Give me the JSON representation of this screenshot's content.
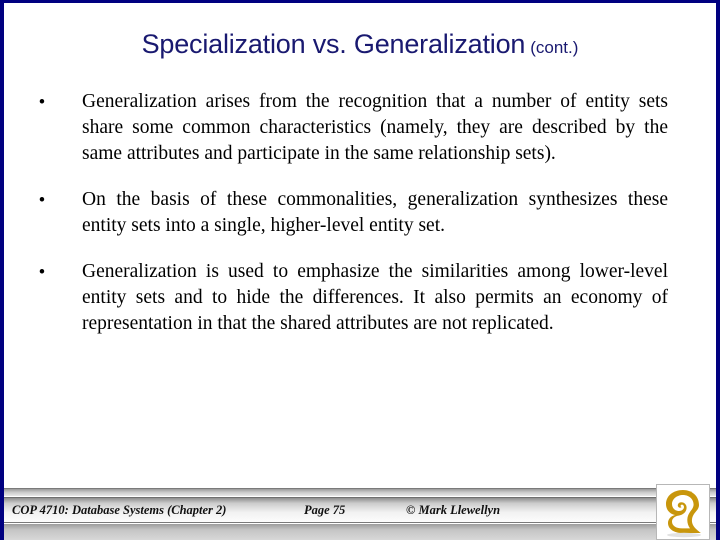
{
  "slide": {
    "border_color": "#000080",
    "background": "#ffffff"
  },
  "title": {
    "main": "Specialization vs. Generalization",
    "suffix": "(cont.)",
    "color": "#191970"
  },
  "body": {
    "bullet_marker": "•",
    "bullets": [
      {
        "text": "Generalization arises from the recognition that a number of entity sets share some common characteristics (namely, they are described by the same attributes and participate in the same relationship sets)."
      },
      {
        "text": "On the basis of these commonalities, generalization synthesizes these entity sets into a single, higher-level entity set."
      },
      {
        "text": "Generalization is used to emphasize the similarities among lower-level entity sets and to hide the differences.  It also permits an economy of representation in that the shared attributes are not replicated."
      }
    ]
  },
  "footer": {
    "course": "COP 4710: Database Systems  (Chapter 2)",
    "page": "Page 75",
    "copyright": "© Mark Llewellyn",
    "logo_name": "ucf-pegasus-logo",
    "logo_color": "#c8960c"
  }
}
